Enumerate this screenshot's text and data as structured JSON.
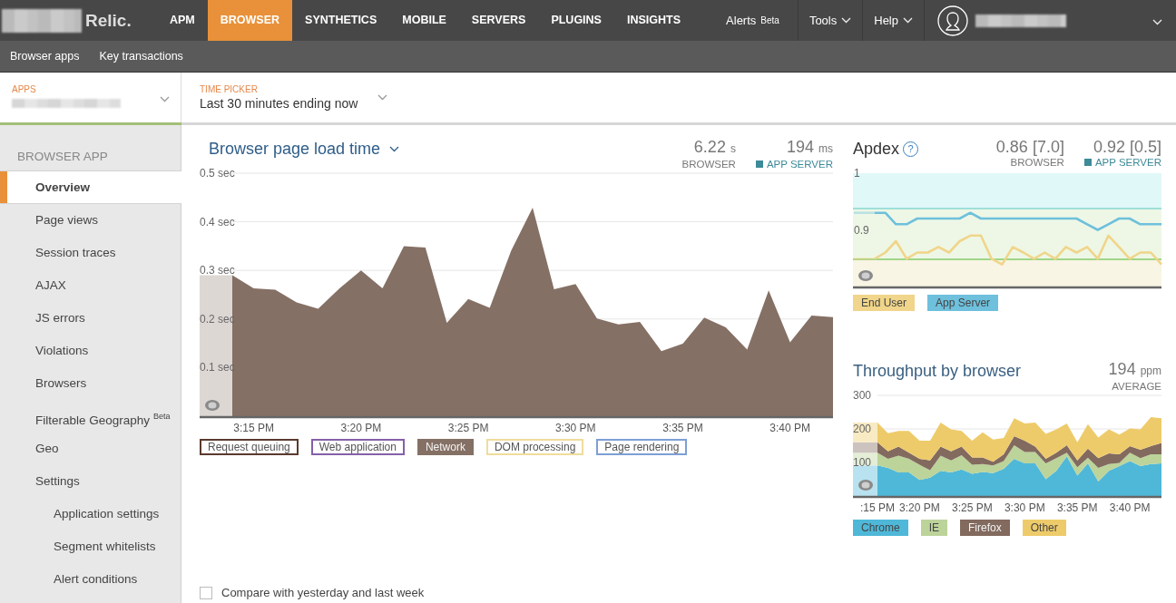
{
  "top_nav": {
    "logo": "Relic.",
    "items": [
      {
        "label": "APM",
        "selected": false
      },
      {
        "label": "BROWSER",
        "selected": true
      },
      {
        "label": "SYNTHETICS",
        "selected": false
      },
      {
        "label": "MOBILE",
        "selected": false
      },
      {
        "label": "SERVERS",
        "selected": false
      },
      {
        "label": "PLUGINS",
        "selected": false
      },
      {
        "label": "INSIGHTS",
        "selected": false
      }
    ],
    "alerts": {
      "label": "Alerts",
      "badge": "Beta"
    },
    "menus": [
      "Tools",
      "Help"
    ]
  },
  "sub_nav": [
    "Browser apps",
    "Key transactions"
  ],
  "pickers": {
    "apps_label": "APPS",
    "time_label": "TIME PICKER",
    "time_value": "Last 30 minutes ending now"
  },
  "sidebar": {
    "heading": "BROWSER APP",
    "items": [
      {
        "label": "Overview",
        "selected": true
      },
      {
        "label": "Page views",
        "selected": false
      },
      {
        "label": "Session traces",
        "selected": false
      },
      {
        "label": "AJAX",
        "selected": false
      },
      {
        "label": "JS errors",
        "selected": false
      },
      {
        "label": "Violations",
        "selected": false
      },
      {
        "label": "Browsers",
        "selected": false
      },
      {
        "label": "Filterable Geography",
        "badge": "Beta",
        "selected": false
      },
      {
        "label": "Geo",
        "selected": false
      },
      {
        "label": "Settings",
        "selected": false,
        "children": [
          {
            "label": "Application settings",
            "selected": false
          },
          {
            "label": "Segment whitelists",
            "selected": false
          },
          {
            "label": "Alert conditions",
            "selected": false
          }
        ]
      }
    ]
  },
  "load_time": {
    "title": "Browser page load time",
    "stats": [
      {
        "value": "6.22",
        "unit": "s",
        "label": "BROWSER"
      },
      {
        "value": "194",
        "unit": "ms",
        "label": "APP SERVER",
        "color": "#3d8a98"
      }
    ],
    "chart_data": {
      "type": "area",
      "ylim": [
        0,
        0.5
      ],
      "grid": true,
      "categories": [
        null,
        "3:15 PM",
        null,
        null,
        null,
        null,
        "3:20 PM",
        null,
        null,
        null,
        null,
        "3:25 PM",
        null,
        null,
        null,
        null,
        "3:30 PM",
        null,
        null,
        null,
        null,
        "3:35 PM",
        null,
        null,
        null,
        null,
        "3:40 PM",
        null,
        null
      ],
      "yticks": [
        {
          "value": 0.1,
          "label": "0.1 sec"
        },
        {
          "value": 0.2,
          "label": "0.2 sec"
        },
        {
          "value": 0.3,
          "label": "0.3 sec"
        },
        {
          "value": 0.4,
          "label": "0.4 sec"
        },
        {
          "value": 0.5,
          "label": "0.5 sec"
        }
      ],
      "series": [
        {
          "name": "Network",
          "color": "#857065",
          "values": [
            0.29,
            0.263,
            0.26,
            0.234,
            0.221,
            0.263,
            0.3,
            0.263,
            0.35,
            0.347,
            0.192,
            0.241,
            0.223,
            0.341,
            0.429,
            0.261,
            0.272,
            0.201,
            0.189,
            0.194,
            0.134,
            0.149,
            0.203,
            0.183,
            0.137,
            0.259,
            0.152,
            0.207,
            0.204
          ]
        }
      ]
    },
    "legend": [
      {
        "kind": "label",
        "label": "Request queuing",
        "color": "#5a3a2e",
        "on": false
      },
      {
        "kind": "label",
        "label": "Web application",
        "color": "#8560a8",
        "on": false
      },
      {
        "kind": "series",
        "on": true
      },
      {
        "kind": "label",
        "label": "DOM processing",
        "color": "#f0dc9c",
        "on": false
      },
      {
        "kind": "label",
        "label": "Page rendering",
        "color": "#7d9fd6",
        "on": false
      }
    ]
  },
  "apdex": {
    "title": "Apdex",
    "help": "?",
    "stats": [
      {
        "value": "0.86 [7.0]",
        "label": "BROWSER"
      },
      {
        "value": "0.92 [0.5]",
        "label": "APP SERVER",
        "color": "#3d8a98"
      }
    ],
    "chart_data": {
      "type": "line",
      "ylim": [
        0.8,
        1
      ],
      "yticks": [
        0.9,
        1
      ],
      "series": [
        {
          "name": "End User",
          "color": "#f0d58a",
          "values": [
            0.849,
            0.86,
            0.88,
            0.849,
            0.86,
            0.86,
            0.87,
            0.86,
            0.88,
            0.89,
            0.89,
            0.849,
            0.839,
            0.87,
            0.86,
            0.849,
            0.86,
            0.849,
            0.87,
            0.86,
            0.87,
            0.849,
            0.89,
            0.87,
            0.849,
            0.86,
            0.86,
            0.839
          ]
        },
        {
          "name": "App Server",
          "color": "#6ec0dc",
          "values": [
            0.93,
            0.93,
            0.91,
            0.91,
            0.92,
            0.92,
            0.92,
            0.92,
            0.92,
            0.93,
            0.92,
            0.92,
            0.92,
            0.92,
            0.92,
            0.92,
            0.92,
            0.92,
            0.92,
            0.92,
            0.91,
            0.9,
            0.91,
            0.92,
            0.92,
            0.91,
            0.91,
            0.91
          ]
        }
      ]
    }
  },
  "throughput": {
    "title": "Throughput by browser",
    "stats": [
      {
        "value": "194",
        "unit": "ppm",
        "label": "AVERAGE"
      }
    ],
    "chart_data": {
      "type": "area",
      "stacked": true,
      "ylim": [
        0,
        300
      ],
      "yticks": [
        100,
        200,
        300
      ],
      "grid": true,
      "categories": [
        ":15 PM",
        null,
        null,
        null,
        "3:20 PM",
        null,
        null,
        null,
        null,
        "3:25 PM",
        null,
        null,
        null,
        null,
        "3:30 PM",
        null,
        null,
        null,
        null,
        "3:35 PM",
        null,
        null,
        null,
        null,
        "3:40 PM",
        null,
        null,
        null
      ],
      "series": [
        {
          "name": "Chrome",
          "color": "#4fb8d8",
          "values": [
            91,
            84,
            70,
            70,
            48,
            55,
            75,
            70,
            79,
            66,
            72,
            68,
            81,
            111,
            97,
            97,
            50,
            75,
            118,
            61,
            97,
            43,
            75,
            89,
            104,
            89,
            95,
            97
          ]
        },
        {
          "name": "IE",
          "color": "#bcd39a",
          "values": [
            38,
            27,
            50,
            41,
            45,
            22,
            45,
            36,
            43,
            27,
            23,
            23,
            23,
            40,
            34,
            34,
            47,
            38,
            11,
            25,
            17,
            41,
            20,
            10,
            25,
            24,
            29,
            27
          ]
        },
        {
          "name": "Firefox",
          "color": "#826a5e",
          "values": [
            31,
            22,
            27,
            18,
            18,
            29,
            27,
            27,
            25,
            22,
            20,
            11,
            20,
            27,
            34,
            16,
            14,
            16,
            22,
            20,
            27,
            29,
            32,
            25,
            20,
            25,
            25,
            34
          ]
        },
        {
          "name": "Other",
          "color": "#eecb6a",
          "values": [
            59,
            54,
            47,
            65,
            54,
            59,
            72,
            66,
            47,
            50,
            75,
            66,
            49,
            54,
            51,
            72,
            74,
            70,
            65,
            54,
            73,
            61,
            72,
            59,
            52,
            61,
            86,
            74
          ]
        }
      ]
    }
  },
  "compare": {
    "label": "Compare with yesterday and last week",
    "checked": false
  }
}
